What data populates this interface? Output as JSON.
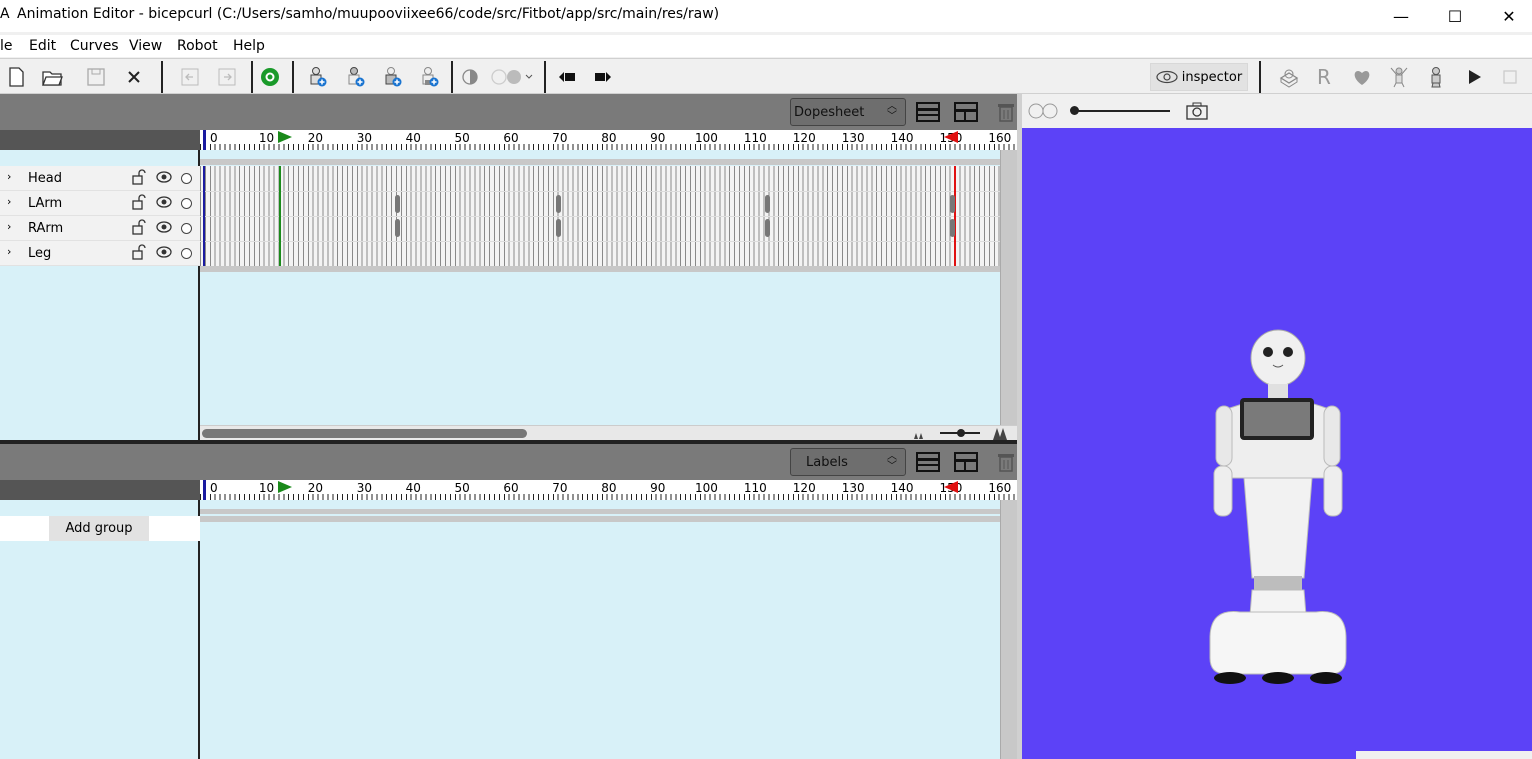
{
  "window": {
    "app_glyph": "A",
    "title": "Animation Editor - bicepcurl (C:/Users/samho/muupooviixee66/code/src/Fitbot/app/src/main/res/raw)",
    "minimize": "—",
    "maximize": "☐",
    "close": "✕"
  },
  "menu": {
    "file": "le",
    "edit": "Edit",
    "curves": "Curves",
    "view": "View",
    "robot": "Robot",
    "help": "Help"
  },
  "toolbar": {
    "inspector_label": "inspector",
    "robot_r": "R"
  },
  "dopesheet": {
    "mode": "Dopesheet",
    "tracks": [
      {
        "label": "Head"
      },
      {
        "label": "LArm"
      },
      {
        "label": "RArm"
      },
      {
        "label": "Leg"
      }
    ],
    "ruler_ticks": [
      "0",
      "10",
      "20",
      "30",
      "40",
      "50",
      "60",
      "70",
      "80",
      "90",
      "100",
      "110",
      "120",
      "130",
      "140",
      "150",
      "160"
    ]
  },
  "labels_panel": {
    "mode": "Labels",
    "add_group": "Add group"
  },
  "colors": {
    "viewport_bg": "#5c42f7",
    "pane_bg": "#d8f1f8",
    "start_marker": "#1a8a1a",
    "end_marker": "#e01010",
    "current_marker": "#1a1aa0"
  }
}
